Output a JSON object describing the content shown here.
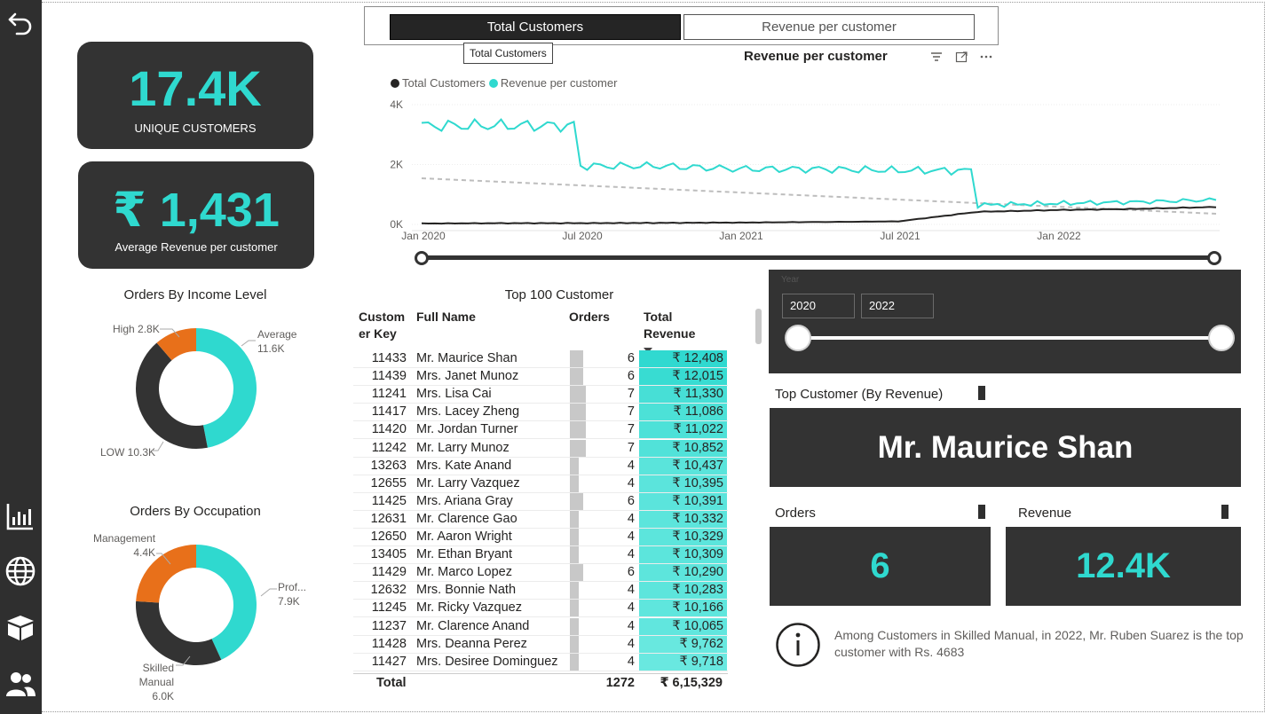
{
  "kpis": {
    "unique_customers": {
      "value": "17.4K",
      "label": "UNIQUE CUSTOMERS"
    },
    "avg_revenue": {
      "value": "₹ 1,431",
      "label": "Average Revenue per customer"
    }
  },
  "toggle": {
    "total_customers": "Total Customers",
    "revenue_per_customer": "Revenue per customer",
    "tooltip": "Total Customers"
  },
  "line_chart": {
    "title": "Revenue per customer",
    "legend": [
      "Total Customers",
      "Revenue per customer"
    ],
    "y_ticks": [
      "4K",
      "2K",
      "0K"
    ],
    "x_ticks": [
      "Jan 2020",
      "Jul 2020",
      "Jan 2021",
      "Jul 2021",
      "Jan 2022"
    ]
  },
  "chart_data": [
    {
      "type": "line",
      "title": "Revenue per customer",
      "x": [
        "Jan 2020",
        "Apr 2020",
        "Jul 2020",
        "Oct 2020",
        "Jan 2021",
        "Apr 2021",
        "Jul 2021",
        "Oct 2021",
        "Jan 2022",
        "Apr 2022",
        "Jun 2022"
      ],
      "series": [
        {
          "name": "Total Customers",
          "color": "#252423",
          "values": [
            30,
            40,
            40,
            50,
            60,
            80,
            100,
            420,
            480,
            520,
            580
          ]
        },
        {
          "name": "Revenue per customer",
          "color": "#2fd9cf",
          "values": [
            3300,
            3300,
            1950,
            1950,
            1850,
            1850,
            1800,
            650,
            700,
            750,
            820
          ]
        }
      ],
      "ylim": [
        0,
        4000
      ],
      "trend_line": "dashed"
    },
    {
      "type": "pie",
      "title": "Orders By Income Level",
      "categories": [
        "Average",
        "LOW",
        "High"
      ],
      "values": [
        11600,
        10300,
        2800
      ],
      "colors": [
        "#2fd9cf",
        "#333333",
        "#e8701a"
      ]
    },
    {
      "type": "pie",
      "title": "Orders By Occupation",
      "categories": [
        "Prof...",
        "Skilled Manual",
        "Management"
      ],
      "values": [
        7900,
        6000,
        4400
      ],
      "colors": [
        "#2fd9cf",
        "#333333",
        "#e8701a"
      ]
    }
  ],
  "income_donut": {
    "title": "Orders By Income Level",
    "labels": {
      "average": "Average",
      "average_val": "11.6K",
      "high": "High 2.8K",
      "low": "LOW 10.3K"
    }
  },
  "occupation_donut": {
    "title": "Orders By Occupation",
    "labels": {
      "prof": "Prof...",
      "prof_val": "7.9K",
      "mgmt": "Management",
      "mgmt_val": "4.4K",
      "skilled": "Skilled Manual",
      "skilled_val": "6.0K"
    }
  },
  "table": {
    "title": "Top 100 Customer",
    "headers": {
      "key": "Custom er Key",
      "name": "Full Name",
      "orders": "Orders",
      "revenue": "Total Revenue"
    },
    "rows": [
      {
        "key": "11433",
        "name": "Mr. Maurice Shan",
        "orders": 6,
        "revenue": "₹ 12,408",
        "rev": 12408
      },
      {
        "key": "11439",
        "name": "Mrs. Janet Munoz",
        "orders": 6,
        "revenue": "₹ 12,015",
        "rev": 12015
      },
      {
        "key": "11241",
        "name": "Mrs. Lisa Cai",
        "orders": 7,
        "revenue": "₹ 11,330",
        "rev": 11330
      },
      {
        "key": "11417",
        "name": "Mrs. Lacey Zheng",
        "orders": 7,
        "revenue": "₹ 11,086",
        "rev": 11086
      },
      {
        "key": "11420",
        "name": "Mr. Jordan Turner",
        "orders": 7,
        "revenue": "₹ 11,022",
        "rev": 11022
      },
      {
        "key": "11242",
        "name": "Mr. Larry Munoz",
        "orders": 7,
        "revenue": "₹ 10,852",
        "rev": 10852
      },
      {
        "key": "13263",
        "name": "Mrs. Kate Anand",
        "orders": 4,
        "revenue": "₹ 10,437",
        "rev": 10437
      },
      {
        "key": "12655",
        "name": "Mr. Larry Vazquez",
        "orders": 4,
        "revenue": "₹ 10,395",
        "rev": 10395
      },
      {
        "key": "11425",
        "name": "Mrs. Ariana Gray",
        "orders": 6,
        "revenue": "₹ 10,391",
        "rev": 10391
      },
      {
        "key": "12631",
        "name": "Mr. Clarence Gao",
        "orders": 4,
        "revenue": "₹ 10,332",
        "rev": 10332
      },
      {
        "key": "12650",
        "name": "Mr. Aaron Wright",
        "orders": 4,
        "revenue": "₹ 10,329",
        "rev": 10329
      },
      {
        "key": "13405",
        "name": "Mr. Ethan Bryant",
        "orders": 4,
        "revenue": "₹ 10,309",
        "rev": 10309
      },
      {
        "key": "11429",
        "name": "Mr. Marco Lopez",
        "orders": 6,
        "revenue": "₹ 10,290",
        "rev": 10290
      },
      {
        "key": "12632",
        "name": "Mrs. Bonnie Nath",
        "orders": 4,
        "revenue": "₹ 10,283",
        "rev": 10283
      },
      {
        "key": "11245",
        "name": "Mr. Ricky Vazquez",
        "orders": 4,
        "revenue": "₹ 10,166",
        "rev": 10166
      },
      {
        "key": "11237",
        "name": "Mr. Clarence Anand",
        "orders": 4,
        "revenue": "₹ 10,065",
        "rev": 10065
      },
      {
        "key": "11428",
        "name": "Mrs. Deanna Perez",
        "orders": 4,
        "revenue": "₹ 9,762",
        "rev": 9762
      },
      {
        "key": "11427",
        "name": "Mrs. Desiree Dominguez",
        "orders": 4,
        "revenue": "₹ 9,718",
        "rev": 9718
      }
    ],
    "total_label": "Total",
    "total_orders": "1272",
    "total_revenue": "₹ 6,15,329"
  },
  "year_slicer": {
    "label": "Year",
    "from": "2020",
    "to": "2022"
  },
  "top_customer": {
    "label": "Top Customer (By Revenue)",
    "name": "Mr. Maurice Shan",
    "orders_label": "Orders",
    "orders_value": "6",
    "revenue_label": "Revenue",
    "revenue_value": "12.4K"
  },
  "insight": {
    "icon": "info-icon",
    "text": "Among Customers in Skilled Manual, in 2022, Mr. Ruben Suarez is the top customer with Rs. 4683"
  },
  "colors": {
    "accent": "#2fd9cf",
    "dark": "#333333",
    "orange": "#e8701a"
  }
}
